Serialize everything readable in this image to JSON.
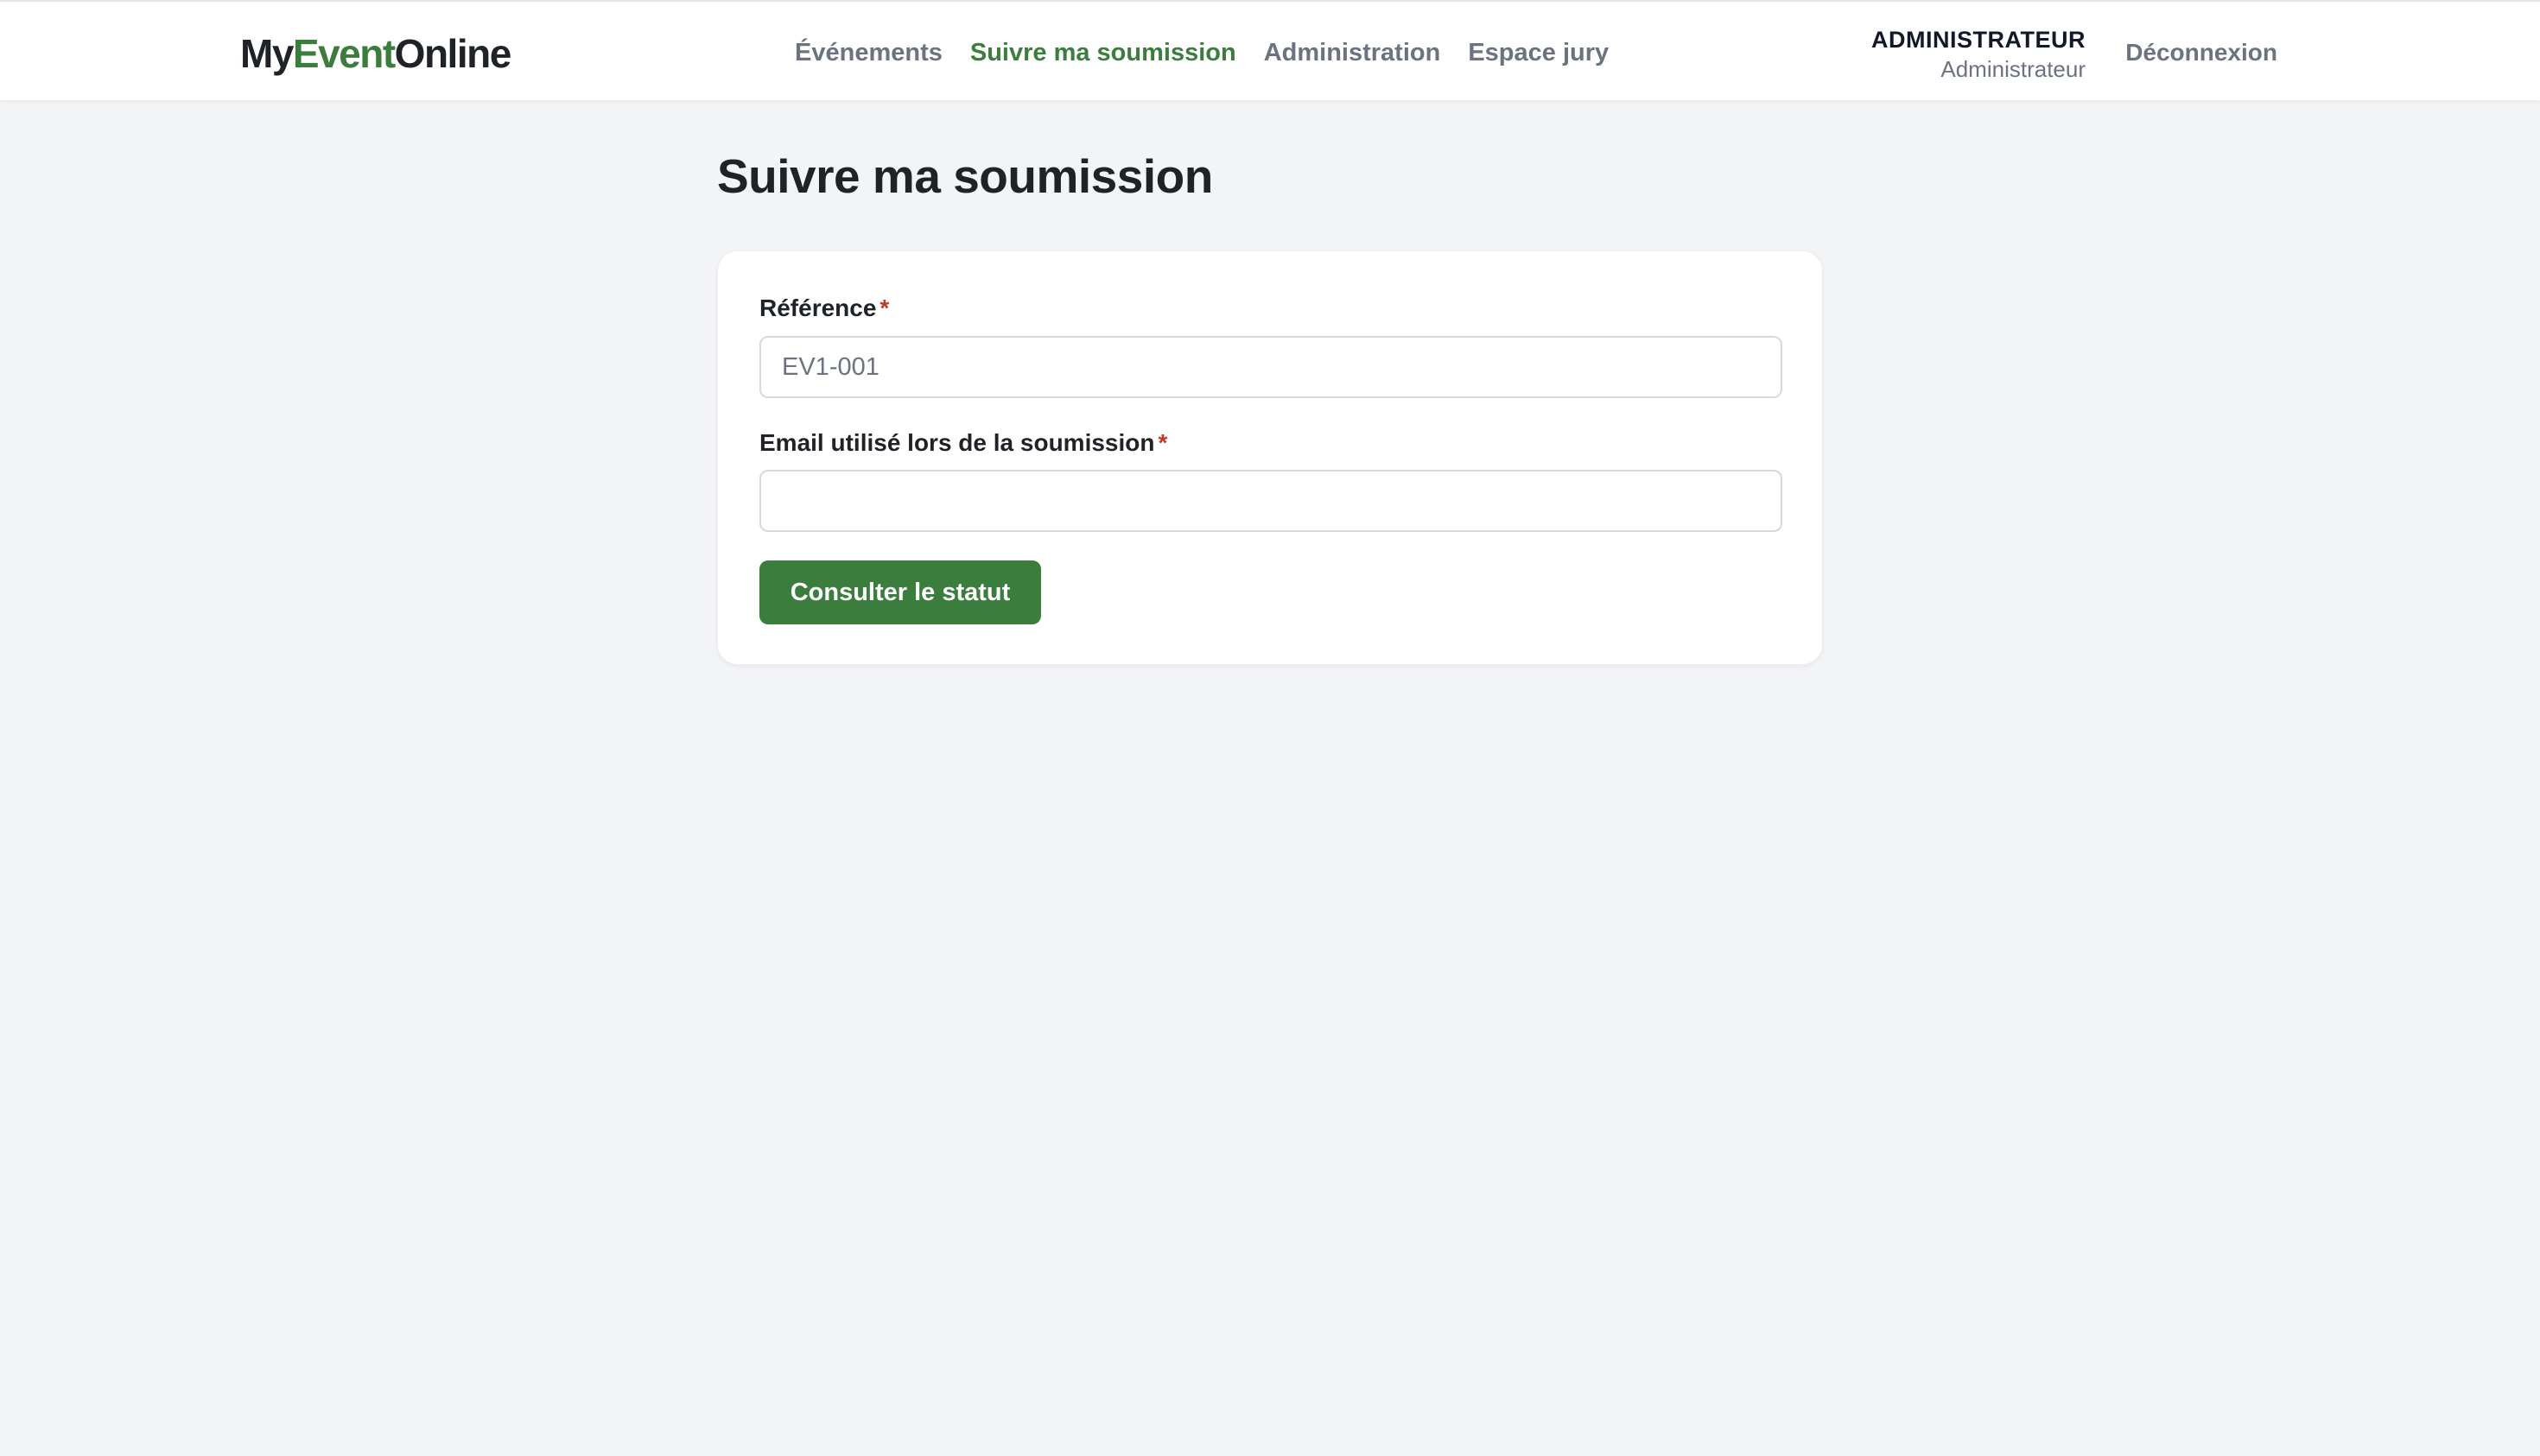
{
  "header": {
    "brand": {
      "part1": "My",
      "part2": "Event",
      "part3": "Online"
    },
    "nav": [
      {
        "label": "Événements",
        "active": false
      },
      {
        "label": "Suivre ma soumission",
        "active": true
      },
      {
        "label": "Administration",
        "active": false
      },
      {
        "label": "Espace jury",
        "active": false
      }
    ],
    "user": {
      "name": "ADMINISTRATEUR",
      "role": "Administrateur"
    },
    "logout_label": "Déconnexion"
  },
  "main": {
    "title": "Suivre ma soumission",
    "form": {
      "reference": {
        "label": "Référence",
        "required_mark": "*",
        "value": "",
        "placeholder": "EV1-001"
      },
      "email": {
        "label": "Email utilisé lors de la soumission",
        "required_mark": "*",
        "value": "",
        "placeholder": ""
      },
      "submit_label": "Consulter le statut"
    }
  },
  "colors": {
    "accent": "#3a7d3d",
    "required": "#c0392b",
    "background": "#f3f4f6"
  }
}
